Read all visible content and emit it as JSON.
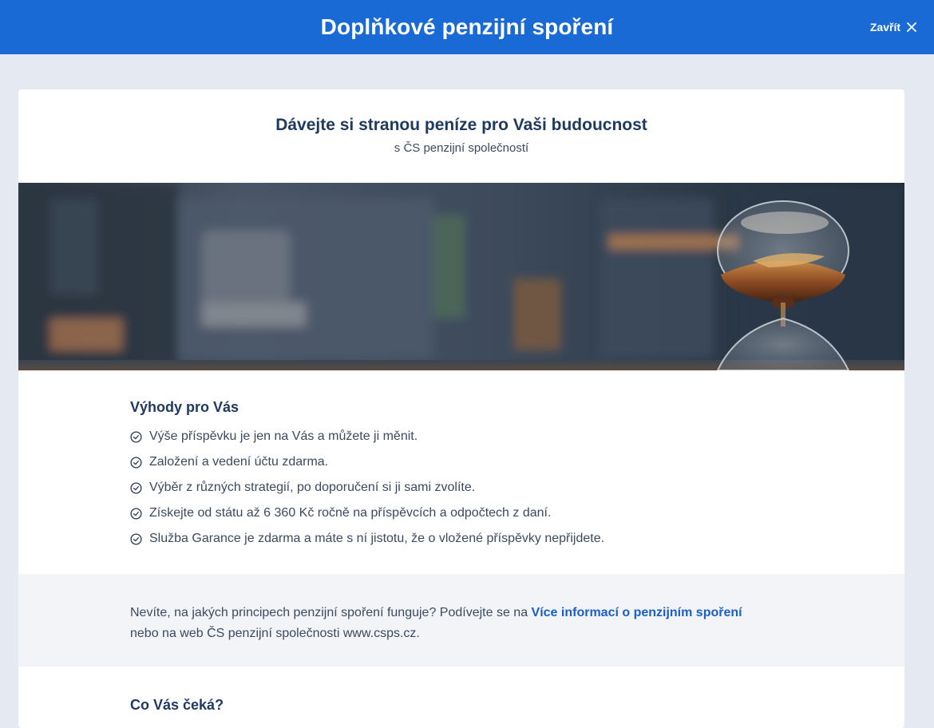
{
  "header": {
    "title": "Doplňkové penzijní spoření",
    "close_label": "Zavřít"
  },
  "card": {
    "title": "Dávejte si stranou peníze pro Vaši budoucnost",
    "subtitle": "s ČS penzijní společností"
  },
  "hero": {
    "subject": "hourglass-with-sand"
  },
  "benefits": {
    "heading": "Výhody pro Vás",
    "items": [
      "Výše příspěvku je jen na Vás a můžete ji měnit.",
      "Založení a vedení účtu zdarma.",
      "Výběr z různých strategií, po doporučení si ji sami zvolíte.",
      "Získejte od státu až 6 360 Kč ročně na příspěvcích a odpočtech z daní.",
      "Služba Garance je zdarma a máte s ní jistotu, že o vložené příspěvky nepřijdete."
    ]
  },
  "info": {
    "text_before": "Nevíte, na jakých principech penzijní spoření funguje? Podívejte se na ",
    "link_label": "Více informací o penzijním spoření",
    "text_after": "nebo na web ČS penzijní společnosti www.csps.cz."
  },
  "next_section": {
    "heading": "Co Vás čeká?"
  },
  "colors": {
    "brand_blue": "#1a6ad6",
    "heading_navy": "#1f3a60",
    "link_blue": "#1a5fc7",
    "page_bg": "#e4e9f2"
  }
}
